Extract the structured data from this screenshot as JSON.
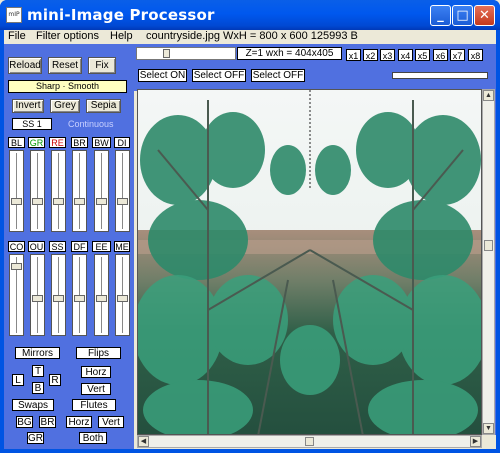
{
  "window": {
    "title": "mini-Image Processor",
    "icon_label": "mIP",
    "buttons": {
      "minimize": "_",
      "maximize": "□",
      "close": "✕"
    }
  },
  "menubar": {
    "file": "File",
    "filter_options": "Filter options",
    "help": "Help",
    "info": "countryside.jpg WxH = 800 x 600  125993  B"
  },
  "toolbar": {
    "zoom_display": "Z=1  wxh = 404x405",
    "zoom_buttons": [
      "x1",
      "x2",
      "x3",
      "x4",
      "x5",
      "x6",
      "x7",
      "x8"
    ],
    "select_on": "Select ON",
    "select_off": "Select OFF",
    "select_off_2": "Select OFF"
  },
  "left_panel": {
    "reload": "Reload",
    "reset": "Reset",
    "fix": "Fix",
    "sharp_smooth": "Sharp · Smooth",
    "invert": "Invert",
    "grey": "Grey",
    "sepia": "Sepia",
    "ss_value": "SS 1",
    "continuous": "Continuous",
    "channels_row1": [
      "BL",
      "GR",
      "RE",
      "BR",
      "BW",
      "DI"
    ],
    "channels_row2": [
      "CO",
      "OU",
      "SS",
      "DF",
      "EE",
      "ME"
    ],
    "mirrors": "Mirrors",
    "flips": "Flips",
    "mirror_l": "L",
    "mirror_t": "T",
    "mirror_r": "R",
    "mirror_b": "B",
    "flip_horz": "Horz",
    "flip_vert": "Vert",
    "swaps": "Swaps",
    "flutes": "Flutes",
    "swap_bg": "BG",
    "swap_br": "BR",
    "swap_gr": "GR",
    "flute_horz": "Horz",
    "flute_vert": "Vert",
    "flute_both": "Both"
  },
  "colors": {
    "title_blue": "#0054e3",
    "panel_blue": "#5070e0",
    "sharp_yellow": "#ffffc0",
    "channel_green": "#009900",
    "channel_red": "#cc0000"
  }
}
